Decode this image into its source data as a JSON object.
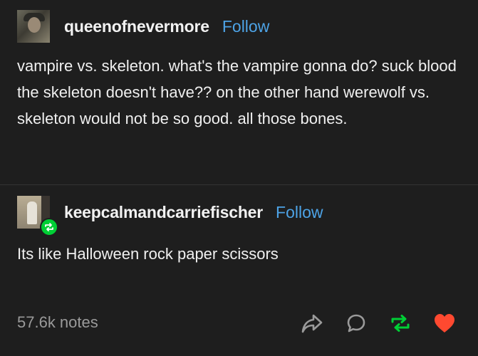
{
  "post": {
    "original": {
      "username": "queenofnevermore",
      "follow_label": "Follow",
      "text": "vampire vs. skeleton. what's the vampire gonna do? suck blood the skeleton doesn't have?? on the other hand werewolf vs. skeleton would not be so good. all those bones."
    },
    "reblog": {
      "username": "keepcalmandcarriefischer",
      "follow_label": "Follow",
      "text": "Its like Halloween rock paper scissors"
    },
    "footer": {
      "notes": "57.6k notes"
    }
  },
  "icons": {
    "share": "share-icon",
    "reply": "reply-icon",
    "reblog": "reblog-icon",
    "like": "heart-icon"
  },
  "colors": {
    "background": "#1e1e1e",
    "follow_link": "#4da3e6",
    "reblog_green": "#00cf35",
    "like_red": "#ff4930",
    "muted": "#9a9a9a"
  }
}
